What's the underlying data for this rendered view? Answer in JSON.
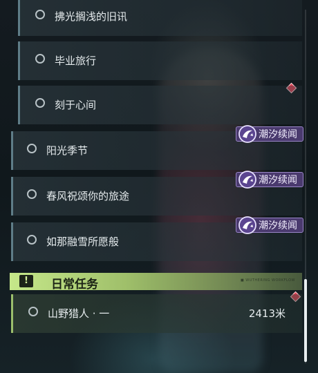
{
  "quests": [
    {
      "label": "拂光搁浅的旧讯",
      "level": "sub"
    },
    {
      "label": "毕业旅行",
      "level": "sub"
    },
    {
      "label": "刻于心间",
      "level": "sub"
    },
    {
      "label": "阳光季节",
      "level": "top",
      "tag": "潮汐续闻"
    },
    {
      "label": "春风祝颂你的旅途",
      "level": "top",
      "tag": "潮汐续闻"
    },
    {
      "label": "如那融雪所愿般",
      "level": "top",
      "tag": "潮汐续闻"
    }
  ],
  "daily_section": {
    "icon": "exclamation-icon",
    "icon_glyph": "!",
    "title": "日常任务",
    "tiny_text": "■ WUTHERING WORKFLOW"
  },
  "daily_quest": {
    "label": "山野猎人 · 一",
    "distance": "2413米"
  },
  "colors": {
    "tag_bg": "#4a3a6e",
    "daily_accent": "#c6e88a",
    "tracker_diamond": "#e04557"
  }
}
